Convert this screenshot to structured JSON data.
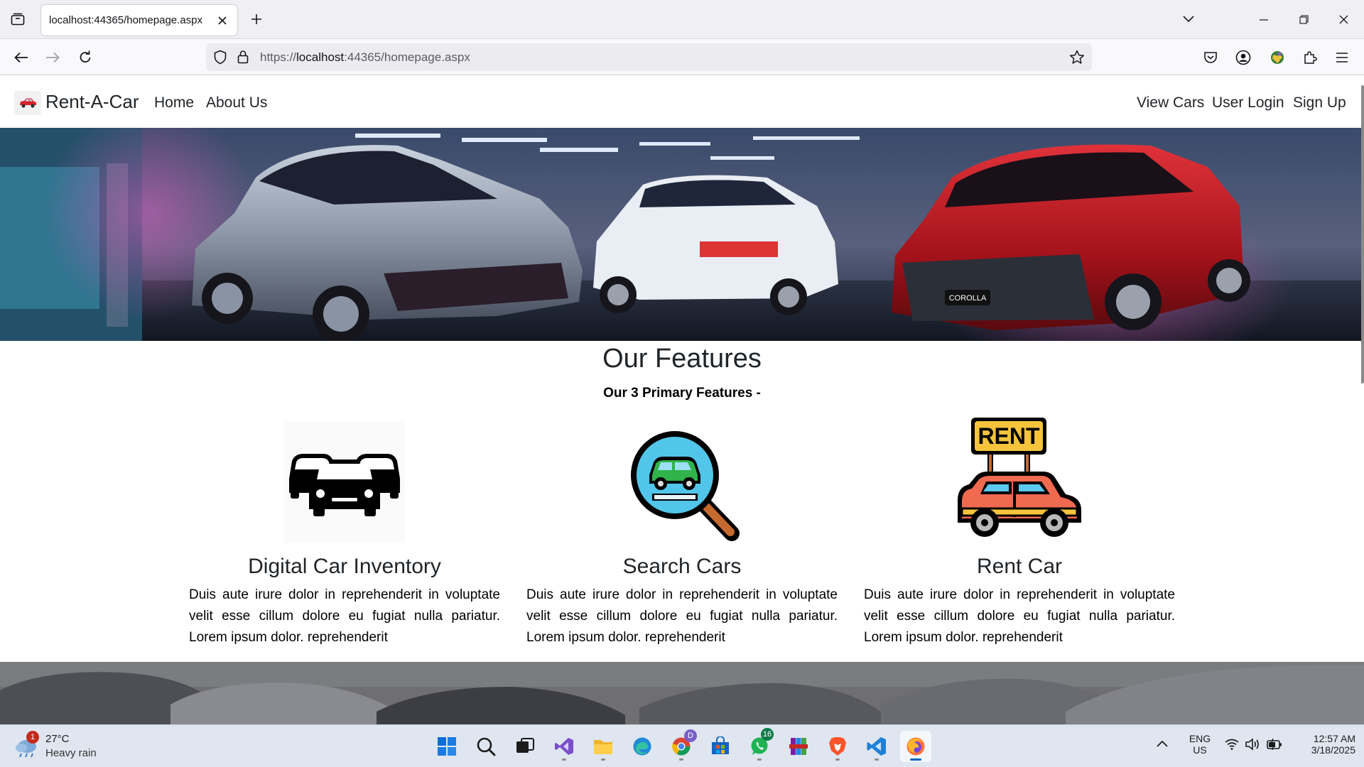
{
  "browser": {
    "tab_title": "localhost:44365/homepage.aspx",
    "url_prefix": "https://",
    "url_host": "localhost",
    "url_rest": ":44365/homepage.aspx"
  },
  "site": {
    "brand": "Rent-A-Car",
    "nav_left": [
      "Home",
      "About Us"
    ],
    "nav_right": [
      "View Cars",
      "User Login",
      "Sign Up"
    ]
  },
  "features": {
    "heading": "Our Features",
    "subheading": "Our 3 Primary Features -",
    "items": [
      {
        "title": "Digital Car Inventory",
        "icon": "car-fleet-icon",
        "description": "Duis aute irure dolor in reprehenderit in voluptate velit esse cillum dolore eu fugiat nulla pariatur. Lorem ipsum dolor. reprehenderit"
      },
      {
        "title": "Search Cars",
        "icon": "search-car-icon",
        "description": "Duis aute irure dolor in reprehenderit in voluptate velit esse cillum dolore eu fugiat nulla pariatur. Lorem ipsum dolor. reprehenderit"
      },
      {
        "title": "Rent Car",
        "icon": "rent-car-icon",
        "description": "Duis aute irure dolor in reprehenderit in voluptate velit esse cillum dolore eu fugiat nulla pariatur. Lorem ipsum dolor. reprehenderit",
        "sign_text": "RENT"
      }
    ]
  },
  "hero": {
    "plate_text": "COROLLA"
  },
  "taskbar": {
    "weather_temp": "27°C",
    "weather_cond": "Heavy rain",
    "weather_badge": "1",
    "whatsapp_badge": "16",
    "chrome_badge": "D",
    "lang_1": "ENG",
    "lang_2": "US",
    "time": "12:57 AM",
    "date": "3/18/2025"
  },
  "colors": {
    "accent": "#0067c0",
    "hero_red": "#b3141c",
    "hero_silver": "#9aa3ae"
  }
}
